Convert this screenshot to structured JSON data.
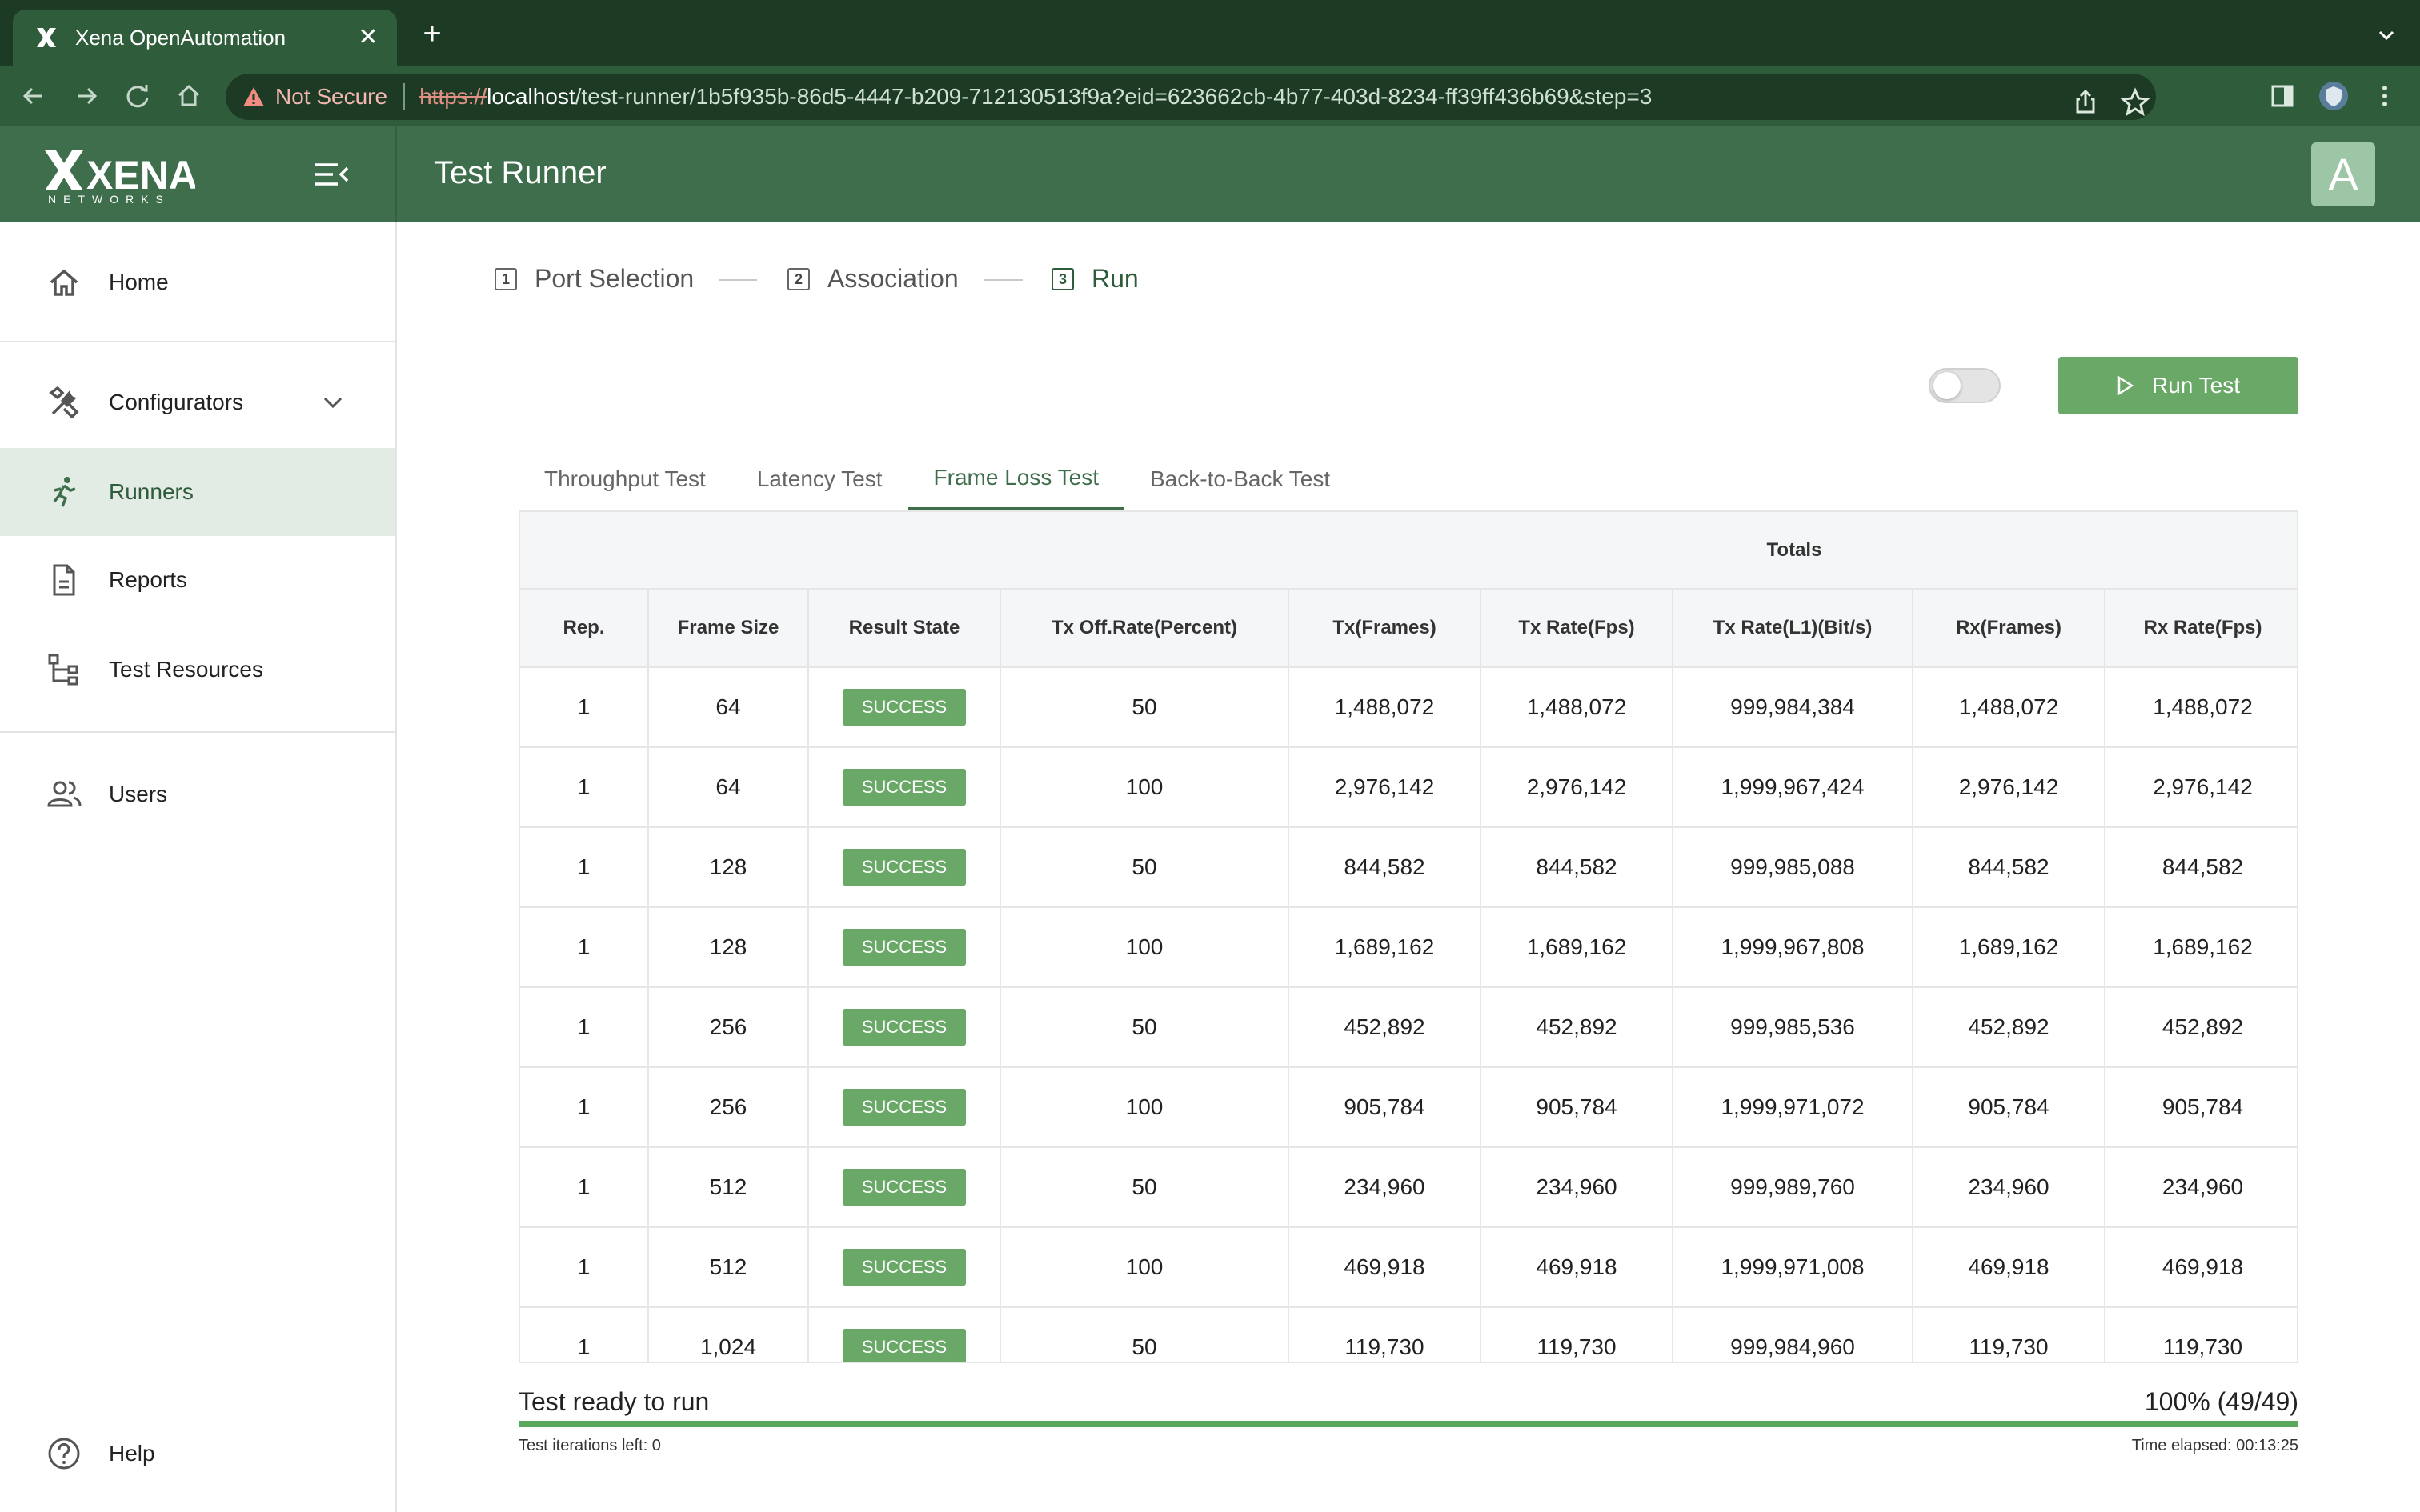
{
  "browser": {
    "tab_title": "Xena OpenAutomation",
    "security_label": "Not Secure",
    "url_scheme": "https://",
    "url_host": "localhost",
    "url_path": "/test-runner/1b5f935b-86d5-4447-b209-712130513f9a?eid=623662cb-4b77-403d-8234-ff39ff436b69&step=3"
  },
  "header": {
    "title": "Test Runner",
    "avatar_letter": "A"
  },
  "brand": {
    "name": "XENA",
    "sub": "NETWORKS"
  },
  "sidebar": {
    "items": [
      {
        "label": "Home",
        "icon": "home-icon"
      },
      {
        "label": "Configurators",
        "icon": "tools-icon"
      },
      {
        "label": "Runners",
        "icon": "runner-icon"
      },
      {
        "label": "Reports",
        "icon": "document-icon"
      },
      {
        "label": "Test Resources",
        "icon": "tree-icon"
      },
      {
        "label": "Users",
        "icon": "users-icon"
      },
      {
        "label": "Help",
        "icon": "help-icon"
      }
    ]
  },
  "stepper": {
    "steps": [
      {
        "num": "1",
        "label": "Port Selection"
      },
      {
        "num": "2",
        "label": "Association"
      },
      {
        "num": "3",
        "label": "Run"
      }
    ]
  },
  "controls": {
    "run_label": "Run Test",
    "toggle_on": false
  },
  "test_tabs": [
    "Throughput Test",
    "Latency Test",
    "Frame Loss Test",
    "Back-to-Back Test"
  ],
  "active_tab": "Frame Loss Test",
  "table": {
    "group_header": "Totals",
    "columns": [
      "Rep.",
      "Frame Size",
      "Result State",
      "Tx Off.Rate(Percent)",
      "Tx(Frames)",
      "Tx Rate(Fps)",
      "Tx Rate(L1)(Bit/s)",
      "Rx(Frames)",
      "Rx Rate(Fps)"
    ],
    "rows": [
      [
        "1",
        "64",
        "SUCCESS",
        "50",
        "1,488,072",
        "1,488,072",
        "999,984,384",
        "1,488,072",
        "1,488,072"
      ],
      [
        "1",
        "64",
        "SUCCESS",
        "100",
        "2,976,142",
        "2,976,142",
        "1,999,967,424",
        "2,976,142",
        "2,976,142"
      ],
      [
        "1",
        "128",
        "SUCCESS",
        "50",
        "844,582",
        "844,582",
        "999,985,088",
        "844,582",
        "844,582"
      ],
      [
        "1",
        "128",
        "SUCCESS",
        "100",
        "1,689,162",
        "1,689,162",
        "1,999,967,808",
        "1,689,162",
        "1,689,162"
      ],
      [
        "1",
        "256",
        "SUCCESS",
        "50",
        "452,892",
        "452,892",
        "999,985,536",
        "452,892",
        "452,892"
      ],
      [
        "1",
        "256",
        "SUCCESS",
        "100",
        "905,784",
        "905,784",
        "1,999,971,072",
        "905,784",
        "905,784"
      ],
      [
        "1",
        "512",
        "SUCCESS",
        "50",
        "234,960",
        "234,960",
        "999,989,760",
        "234,960",
        "234,960"
      ],
      [
        "1",
        "512",
        "SUCCESS",
        "100",
        "469,918",
        "469,918",
        "1,999,971,008",
        "469,918",
        "469,918"
      ],
      [
        "1",
        "1,024",
        "SUCCESS",
        "50",
        "119,730",
        "119,730",
        "999,984,960",
        "119,730",
        "119,730"
      ]
    ]
  },
  "status": {
    "text": "Test ready to run",
    "percent": "100% (49/49)",
    "progress": 1.0,
    "iterations_left": "Test iterations left: 0",
    "elapsed": "Time elapsed: 00:13:25"
  },
  "colors": {
    "primary": "#3e6e4b",
    "success": "#6aa868",
    "chrome": "#1c3a24"
  }
}
